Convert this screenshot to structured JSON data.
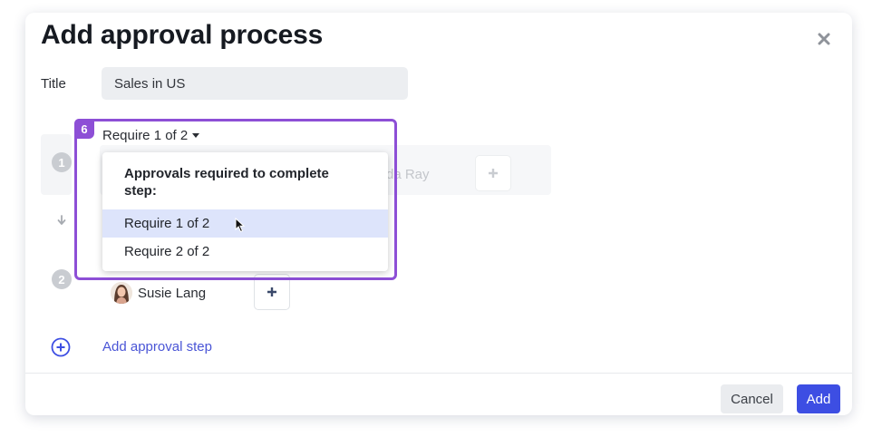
{
  "modal": {
    "title": "Add approval process",
    "close_icon": "close-x-icon"
  },
  "title_field": {
    "label": "Title",
    "value": "Sales in US"
  },
  "steps": [
    {
      "number": "1",
      "require_label": "Require 1 of 2",
      "visible_approver": "da Ray",
      "add_icon": "plus-icon"
    },
    {
      "number": "2",
      "approver": "Susie Lang",
      "add_icon": "plus-icon"
    }
  ],
  "step_connector_icon": "arrow-down-icon",
  "dropdown": {
    "heading": "Approvals required to complete step:",
    "options": [
      "Require 1 of 2",
      "Require 2 of 2"
    ],
    "selected": "Require 1 of 2"
  },
  "highlight_badge": "6",
  "add_step": {
    "icon": "plus-circle-icon",
    "label": "Add approval step"
  },
  "footer": {
    "cancel_label": "Cancel",
    "add_label": "Add"
  },
  "colors": {
    "primary": "#3d4ee3",
    "link": "#4a55d6",
    "highlight": "#8d4fd6",
    "selected_option": "#dde4fb"
  }
}
